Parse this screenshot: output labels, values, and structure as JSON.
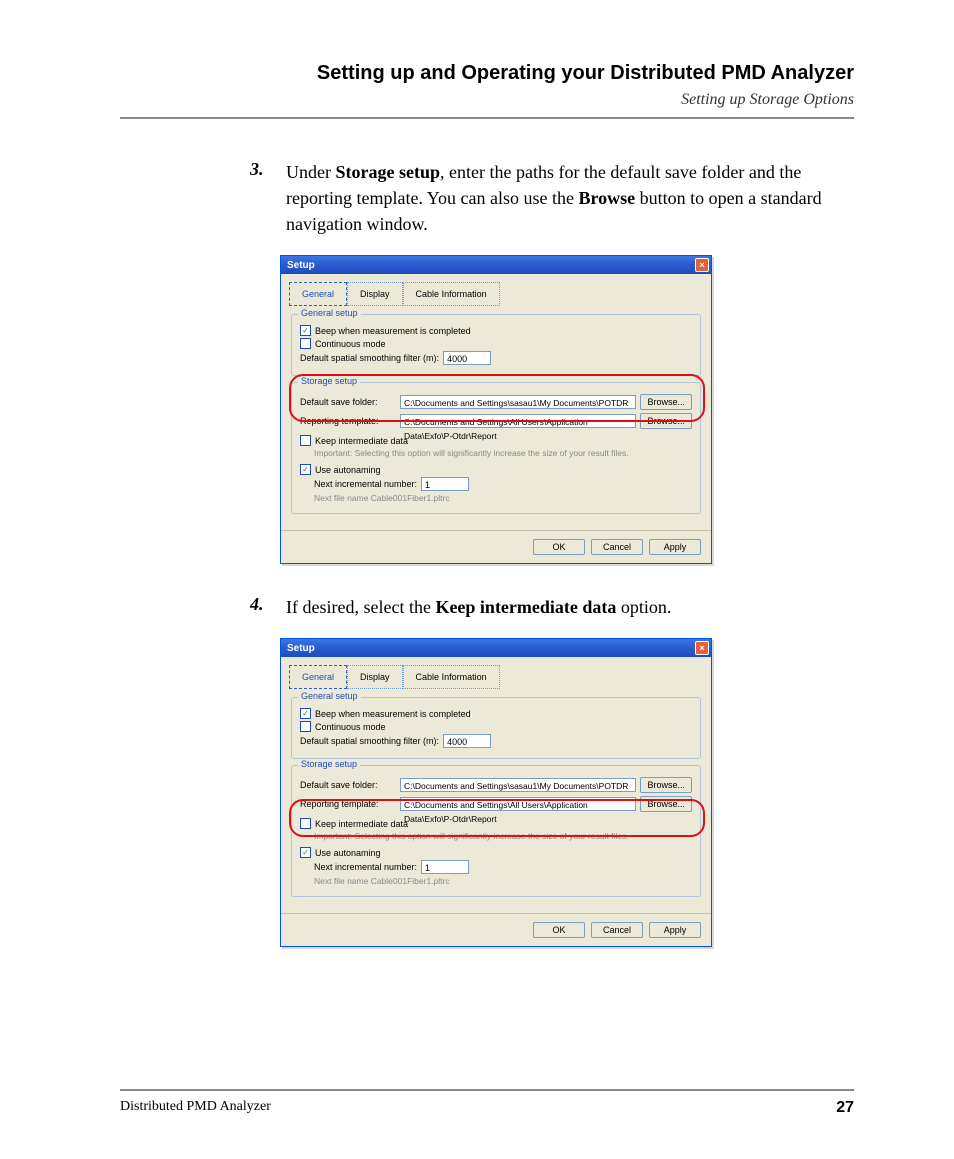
{
  "header": {
    "title": "Setting up and Operating your Distributed PMD Analyzer",
    "subtitle": "Setting up Storage Options"
  },
  "step3": {
    "num": "3.",
    "pre": "Under ",
    "bold1": "Storage setup",
    "mid": ", enter the paths for the default save folder and the reporting template. You can also use the ",
    "bold2": "Browse",
    "post": " button to open a standard navigation window."
  },
  "step4": {
    "num": "4.",
    "pre": "If desired, select the ",
    "bold1": "Keep intermediate data",
    "post": " option."
  },
  "dialog": {
    "title": "Setup",
    "close_glyph": "×",
    "tabs": {
      "general": "General",
      "display": "Display",
      "cable": "Cable Information"
    },
    "general_setup": {
      "legend": "General setup",
      "beep_checked": "✓",
      "beep_label": "Beep when measurement is completed",
      "cont_label": "Continuous mode",
      "filter_label": "Default spatial smoothing filter (m):",
      "filter_value": "4000"
    },
    "storage_setup": {
      "legend": "Storage setup",
      "save_label": "Default save folder:",
      "save_value": "C:\\Documents and Settings\\sasau1\\My Documents\\POTDR",
      "tmpl_label": "Reporting template:",
      "tmpl_value": "C:\\Documents and Settings\\All Users\\Application Data\\Exfo\\P-Otdr\\Report",
      "browse": "Browse...",
      "keep_label": "Keep intermediate data",
      "keep_note": "Important: Selecting this option will significantly increase the size of your result files.",
      "auto_checked": "✓",
      "auto_label": "Use autonaming",
      "incr_label": "Next incremental number:",
      "incr_value": "1",
      "nextfile_label": "Next file name Cable001Fiber1.pltrc"
    },
    "buttons": {
      "ok": "OK",
      "cancel": "Cancel",
      "apply": "Apply"
    }
  },
  "footer": {
    "doc": "Distributed PMD Analyzer",
    "page": "27"
  }
}
